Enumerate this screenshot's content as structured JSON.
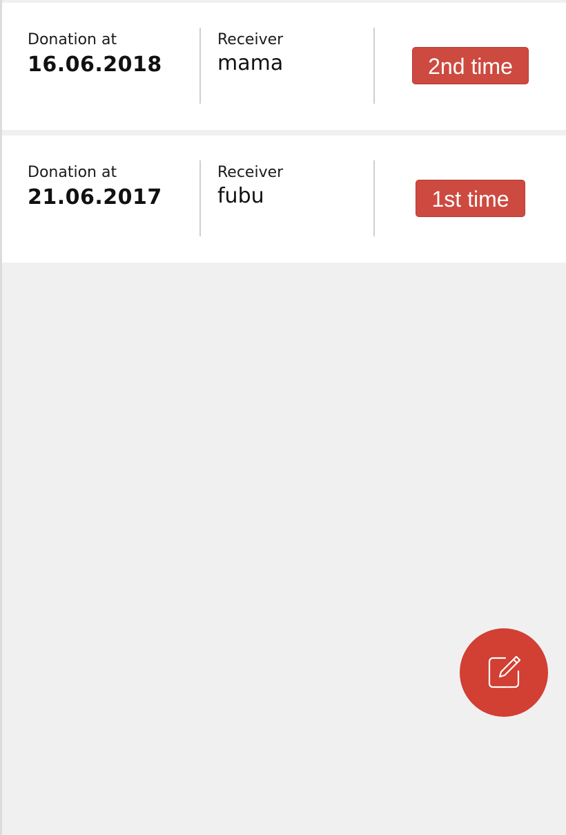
{
  "donations": [
    {
      "date_label": "Donation at",
      "date": "16.06.2018",
      "receiver_label": "Receiver",
      "receiver": "mama",
      "count_badge": "2nd time"
    },
    {
      "date_label": "Donation at",
      "date": "21.06.2017",
      "receiver_label": "Receiver",
      "receiver": "fubu",
      "count_badge": "1st time"
    }
  ],
  "fab": {
    "icon": "edit-icon"
  },
  "colors": {
    "accent": "#d23f33",
    "badge": "#cd4a40",
    "background": "#f0f0f0",
    "card": "#ffffff"
  }
}
